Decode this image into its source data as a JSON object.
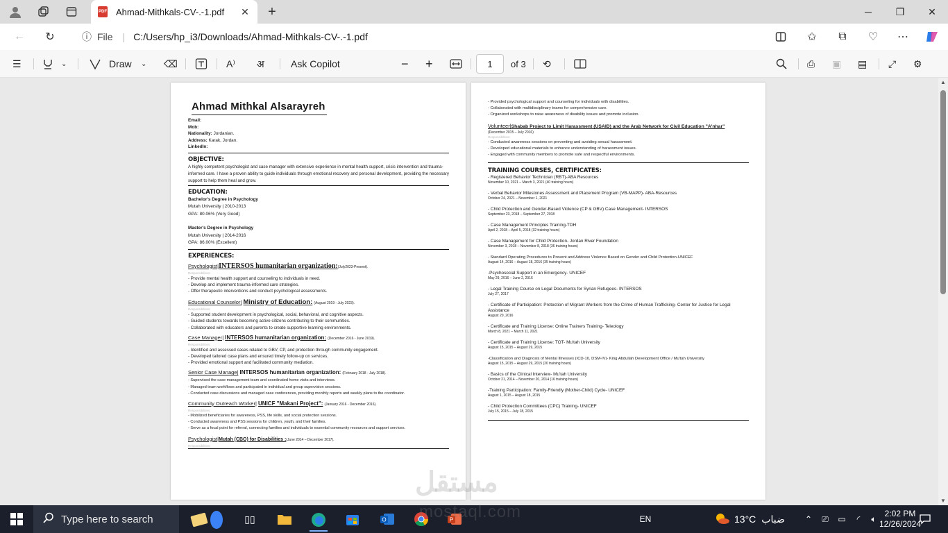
{
  "browser": {
    "tab_title": "Ahmad-Mithkals-CV-.-1.pdf",
    "pdf_badge": "PDF",
    "file_label": "File",
    "url": "C:/Users/hp_i3/Downloads/Ahmad-Mithkals-CV-.-1.pdf"
  },
  "pdf_toolbar": {
    "draw_label": "Draw",
    "copilot_label": "Ask Copilot",
    "page_number": "1",
    "page_total": "of 3"
  },
  "cv": {
    "name": "Ahmad Mithkal Alsarayreh",
    "contact": [
      {
        "label": "Email:",
        "value": ""
      },
      {
        "label": "Mob:",
        "value": ""
      },
      {
        "label": "Nationality:",
        "value": "Jordanian."
      },
      {
        "label": "Address:",
        "value": "Karak, Jordan."
      },
      {
        "label": "LinkedIn:",
        "value": ""
      }
    ],
    "objective_heading": "OBJECTIVE:",
    "objective_text": "A highly competent psychologist and case manager with extensive experience in mental health support, crisis intervention and trauma-informed care. I have a proven ability to guide individuals through emotional recovery and personal development, providing the necessary support to help them heal and grow.",
    "education_heading": "EDUCATION:",
    "education": [
      {
        "degree": "Bachelor's Degree in Psychology",
        "school": "Mutah University | 2010-2013",
        "gpa": "GPA: 80.06% (Very Good)"
      },
      {
        "degree": "Master's Degree in Psychology",
        "school": "Mutah University | 2014-2016",
        "gpa": "GPA: 86.00% (Excellent)"
      }
    ],
    "experience_heading": "EXPERIENCES:",
    "responsibilities_label": "Responsibilities:",
    "experiences": [
      {
        "role": "Psychologist|",
        "org": "INTERSOS humanitarian organization:",
        "date": "(July2023-Present).",
        "bullets": [
          "- Provide mental health support and counseling to individuals in need.",
          "- Develop and implement trauma-informed care strategies.",
          "- Offer therapeutic interventions and conduct psychological assessments."
        ]
      },
      {
        "role": "Educational Counselor|",
        "org": "Ministry of Education:",
        "date": "(August 2019 - July 2023).",
        "bullets": [
          "- Supported student development in psychological, social, behavioral, and cognitive aspects.",
          "- Guided students towards becoming active citizens contributing to their communities.",
          "- Collaborated with educators and parents to create supportive learning environments."
        ]
      },
      {
        "role": "Case Manager|",
        "org": "INTERSOS humanitarian organization:",
        "date": "(December 2016 - June 2019).",
        "bullets": [
          "- Identified and assessed cases related to GBV, CP, and protection through community engagement.",
          "- Developed tailored case plans and ensured timely follow-up on services.",
          "- Provided emotional support and facilitated community mediation."
        ]
      },
      {
        "role": "Senior Case Manage|",
        "org": "INTERSOS humanitarian organization:",
        "date": "(February 2018 - July 2018).",
        "bullets": [
          "- Supervised the case management team and coordinated home visits and interviews.",
          "- Managed team workflows and participated in individual and group supervision sessions.",
          "- Conducted case discussions and managed case conferences, providing monthly reports and weekly plans to the coordinator."
        ]
      },
      {
        "role": "Community Outreach Worker|",
        "org": "UNICF \"Makani Project\":",
        "date": "(January 2016 - December 2016).",
        "bullets": [
          "- Mobilized beneficiaries for awareness, PSS, life skills, and social protection sessions.",
          "- Conducted awareness and PSS sessions for children, youth, and their families.",
          "- Serve as a focal point for referral, connecting families and individuals to essential community resources and support services."
        ]
      },
      {
        "role": "Psychologist|",
        "org": "Mutah (CBO) for Disabilities :",
        "date": "(June 2014 – December 2017).",
        "bullets": []
      }
    ],
    "page2_bullets": [
      "- Provided psychological support and counseling for individuals with disabilities.",
      "- Collaborated with multidisciplinary teams for comprehensive care.",
      "- Organized workshops to raise awareness of disability issues and promote inclusion."
    ],
    "volunteer": {
      "role": "Volunteer|",
      "org": "Shabab Project to Limit Harassment (USAID) and the Arab Network for Civil Education \"A'nhar\"",
      "date": "(December 2015 – July 2016)",
      "bullets": [
        "- Conducted awareness sessions on preventing and avoiding sexual harassment.",
        "- Developed educational materials to enhance understanding of harassment issues.",
        "- Engaged with community members to promote safe and respectful environments."
      ]
    },
    "training_heading": "TRAINING COURSES, CERTIFICATES:",
    "training": [
      {
        "title": "- Registered Behavior Technician (RBT)-ABA Resources",
        "date": "November 10, 2021 – March 3, 2021 (40 training hours)"
      },
      {
        "title": "- Verbal Behavior Milestones Assessment and Placement Program (VB-MAPP)- ABA-Resources",
        "date": "October 24, 2021 – November 1, 2021"
      },
      {
        "title": "- Child Protection and Gender-Based Violence (CP & GBV) Case Management- INTERSOS",
        "date": "September 23, 2018 – September 27, 2018"
      },
      {
        "title": "- Case Management Principles Training-TDH",
        "date": "April 2, 2018 – April 5, 2018 (32 training hours)"
      },
      {
        "title": "- Case Management for Child Protection- Jordan River Foundation",
        "date": "November 3, 2018 – November 8, 2018 (36 training hours)"
      },
      {
        "title": "- Standard Operating Procedures to Prevent and Address Violence Based on Gender and Child Protection-UNICEF",
        "date": "August 14, 2016 – August 18, 2016 (35 training hours)"
      },
      {
        "title": "-Psychosocial Support in an Emergency- UNICEF",
        "date": "May 29, 2016 – June 2, 2016"
      },
      {
        "title": "- Legal Training Course on Legal Documents for Syrian Refugees- INTERSOS",
        "date": "July 27, 2017"
      },
      {
        "title": "- Certificate of Participation: Protection of Migrant Workers from the Crime of Human Trafficking- Center for Justice for Legal Assistance",
        "date": "August 20, 2016"
      },
      {
        "title": "- Certificate and Training License: Online Trainers Training- Teleology",
        "date": "March 8, 2021 – March 11, 2021"
      },
      {
        "title": "- Certificate and Training License: TOT- Mu'tah University",
        "date": "August 15, 2015 – August 29, 2015"
      },
      {
        "title": "-Classification and Diagnosis of Mental Illnesses (ICD-10, DSM-IV)- King Abdullah Development Office / Mu'tah University",
        "date": "August 15, 2015 – August 29, 2015 (20 training hours)"
      },
      {
        "title": "- Basics of the Clinical Interview- Mu'tah University",
        "date": "October 21, 2014 – November 20, 2014 (16 training hours)"
      },
      {
        "title": "-Training Participation: Family-Friendly (Mother-Child) Cycle- UNICEF",
        "date": "August 1, 2015 – August 18, 2015"
      },
      {
        "title": "- Child Protection Committees (CPC) Training- UNICEF",
        "date": "July 15, 2015 – July 18, 2015"
      }
    ]
  },
  "watermark": {
    "arabic": "مستقل",
    "latin": "mostaql.com"
  },
  "taskbar": {
    "search_placeholder": "Type here to search",
    "lang": "EN",
    "weather_temp": "13°C",
    "weather_desc": "ضباب",
    "time": "2:02 PM",
    "date": "12/26/2024"
  }
}
